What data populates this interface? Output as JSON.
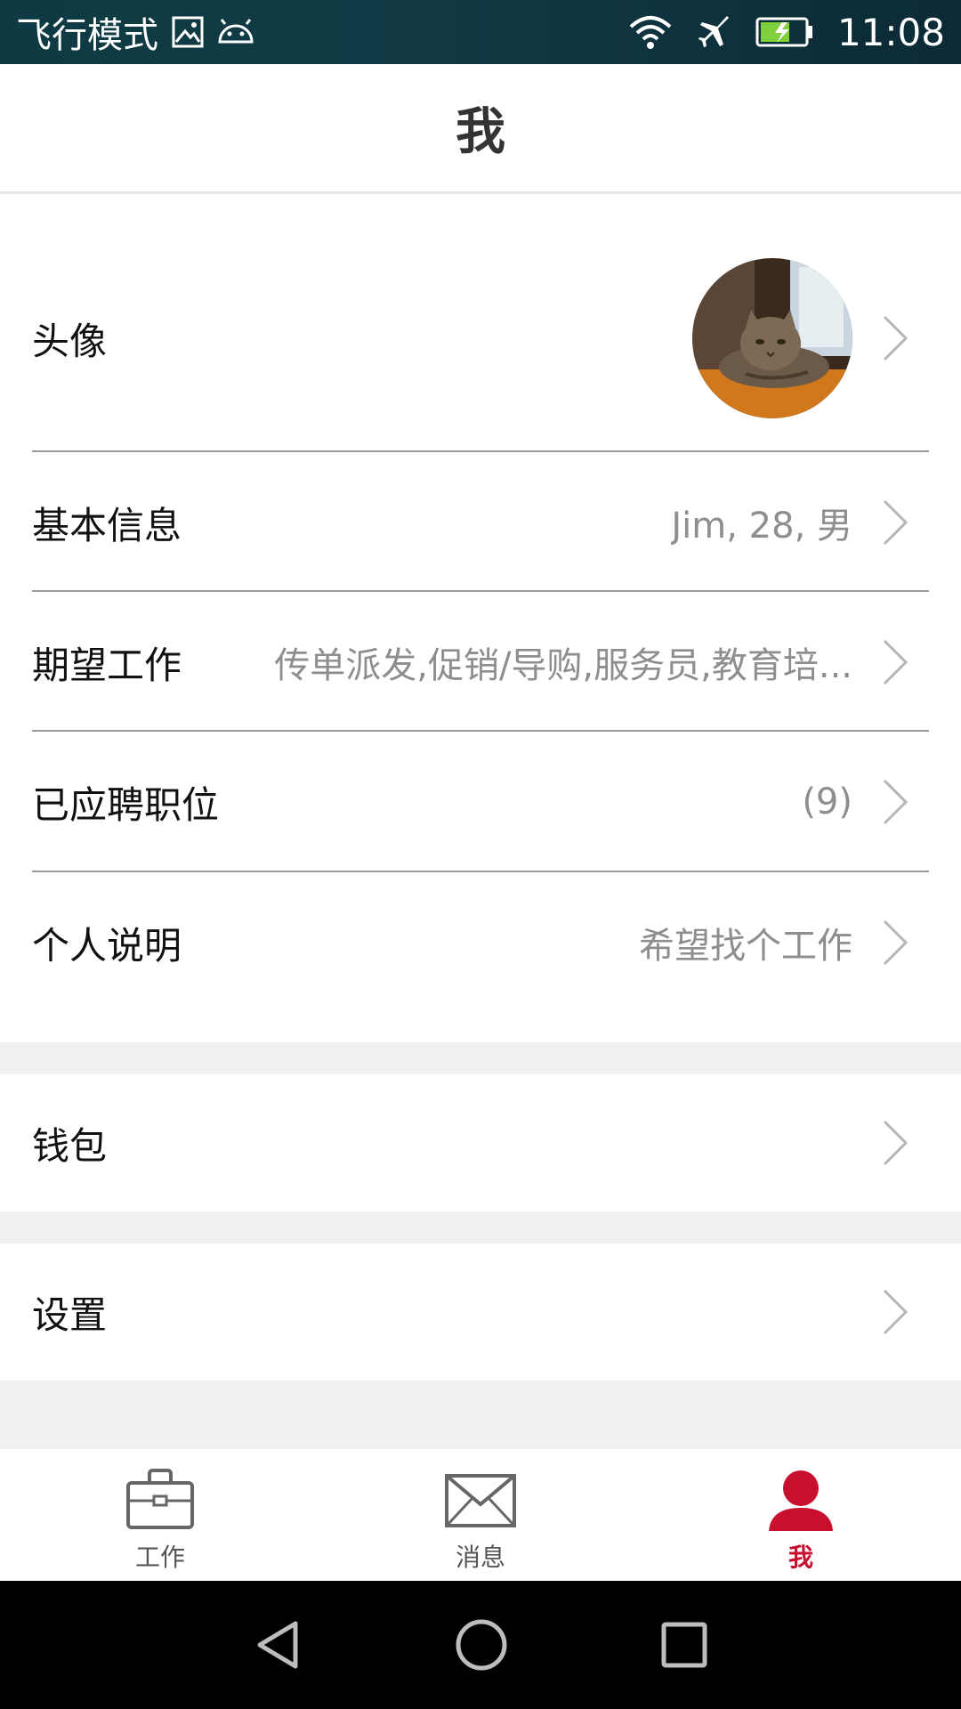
{
  "status_bar": {
    "mode_label": "飞行模式",
    "time": "11:08"
  },
  "header": {
    "title": "我"
  },
  "profile": {
    "avatar_label": "头像",
    "basic_info": {
      "label": "基本信息",
      "value": "Jim, 28, 男"
    },
    "expected_job": {
      "label": "期望工作",
      "value": "传单派发,促销/导购,服务员,教育培..."
    },
    "applied": {
      "label": "已应聘职位",
      "value": "(9)"
    },
    "personal_note": {
      "label": "个人说明",
      "value": "希望找个工作"
    }
  },
  "wallet": {
    "label": "钱包"
  },
  "settings": {
    "label": "设置"
  },
  "tabs": [
    {
      "label": "工作",
      "icon": "briefcase-icon",
      "active": false
    },
    {
      "label": "消息",
      "icon": "envelope-icon",
      "active": false
    },
    {
      "label": "我",
      "icon": "person-icon",
      "active": true
    }
  ],
  "colors": {
    "accent": "#c8102e",
    "status_bar": "#0e3b43",
    "value_text": "#8e8e8e",
    "section_gap": "#f0f0f0"
  }
}
